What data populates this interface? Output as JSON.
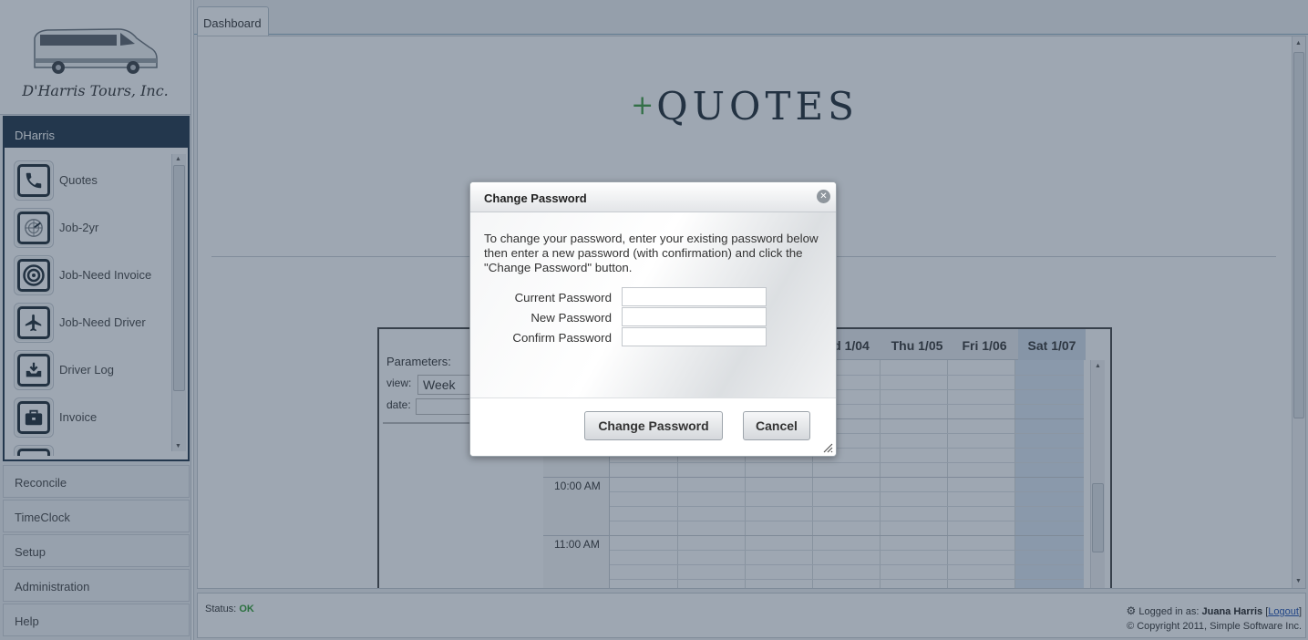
{
  "sidebar": {
    "logo_text": "D'Harris Tours, Inc.",
    "group_title": "DHarris",
    "items": [
      {
        "label": "Quotes",
        "icon": "phone-icon"
      },
      {
        "label": "Job-2yr",
        "icon": "radar-icon"
      },
      {
        "label": "Job-Need Invoice",
        "icon": "target-icon"
      },
      {
        "label": "Job-Need Driver",
        "icon": "airplane-icon"
      },
      {
        "label": "Driver Log",
        "icon": "inbox-download-icon"
      },
      {
        "label": "Invoice",
        "icon": "briefcase-icon"
      }
    ],
    "sections": [
      {
        "label": "Reconcile"
      },
      {
        "label": "TimeClock"
      },
      {
        "label": "Setup"
      },
      {
        "label": "Administration"
      },
      {
        "label": "Help"
      }
    ]
  },
  "tabs": [
    {
      "label": "Dashboard"
    }
  ],
  "dashboard": {
    "brand_plus": "+",
    "brand_title": "QUOTES",
    "paren_fragment": ")"
  },
  "calendar": {
    "params_label": "Parameters:",
    "view_label": "view:",
    "view_value": "Week",
    "date_label": "date:",
    "day_headers": [
      "d 1/04",
      "Thu 1/05",
      "Fri 1/06",
      "Sat 1/07"
    ],
    "times": [
      "10:00 AM",
      "11:00 AM"
    ]
  },
  "status_bar": {
    "status_label": "Status:",
    "status_value": "OK",
    "logged_in_prefix": "Logged in as:",
    "user_name": "Juana Harris",
    "logout_label": "Logout",
    "copyright": "© Copyright 2011, Simple Software Inc."
  },
  "modal": {
    "title": "Change Password",
    "description": "To change your password, enter your existing password below then enter a new password (with confirmation) and click the \"Change Password\" button.",
    "fields": [
      {
        "label": "Current Password",
        "value": ""
      },
      {
        "label": "New Password",
        "value": ""
      },
      {
        "label": "Confirm Password",
        "value": ""
      }
    ],
    "submit_label": "Change Password",
    "cancel_label": "Cancel"
  }
}
